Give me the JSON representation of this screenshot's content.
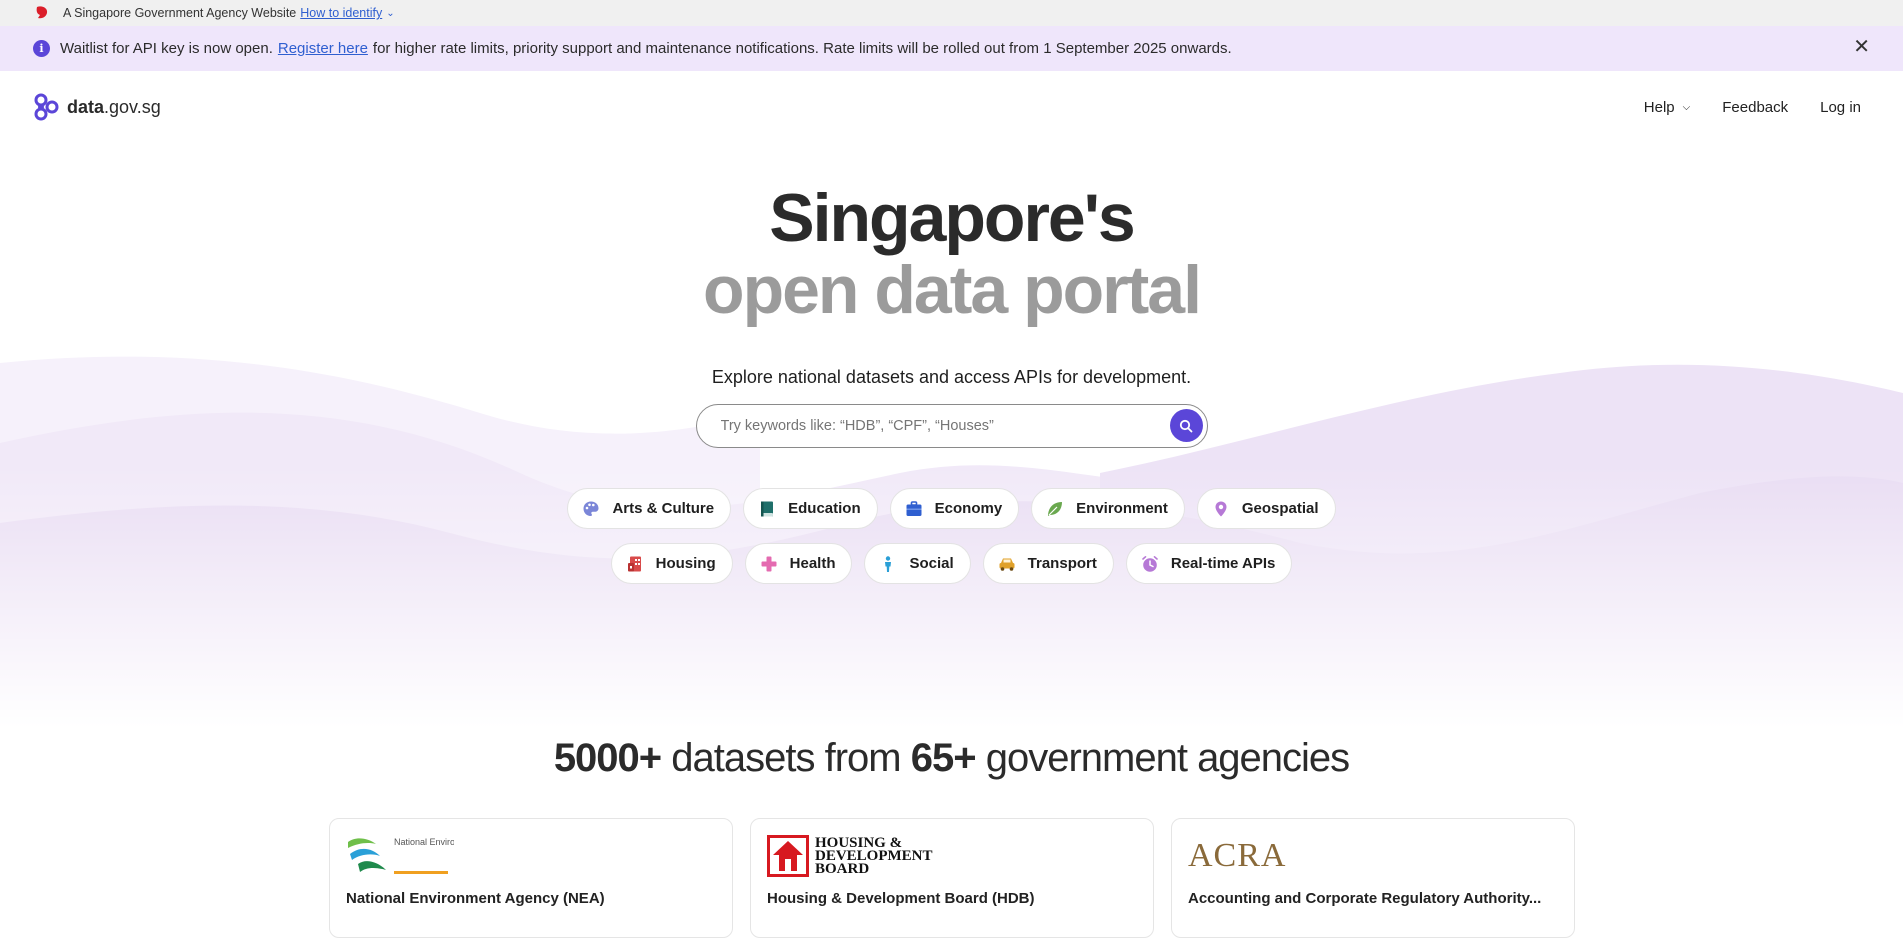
{
  "masthead": {
    "text": "A Singapore Government Agency Website",
    "link": "How to identify"
  },
  "banner": {
    "text_before": "Waitlist for API key is now open.",
    "link": "Register here",
    "text_after": "for higher rate limits, priority support and maintenance notifications. Rate limits will be rolled out from 1 September 2025 onwards.",
    "close": "✕"
  },
  "nav": {
    "logo_bold": "data",
    "logo_rest": ".gov.sg",
    "help": "Help",
    "feedback": "Feedback",
    "login": "Log in"
  },
  "hero": {
    "title_line1": "Singapore's",
    "title_line2": "open data portal",
    "subtitle": "Explore national datasets and access APIs for development.",
    "search_placeholder": "Try keywords like: “HDB”, “CPF”, “Houses”"
  },
  "categories_row1": [
    {
      "label": "Arts & Culture",
      "icon": "palette-icon",
      "color": "#7b86d8"
    },
    {
      "label": "Education",
      "icon": "book-icon",
      "color": "#1f6f6a"
    },
    {
      "label": "Economy",
      "icon": "briefcase-icon",
      "color": "#2f5fd0"
    },
    {
      "label": "Environment",
      "icon": "leaf-icon",
      "color": "#6aa84f"
    },
    {
      "label": "Geospatial",
      "icon": "pin-icon",
      "color": "#b679d6"
    }
  ],
  "categories_row2": [
    {
      "label": "Housing",
      "icon": "building-icon",
      "color": "#d84a4a"
    },
    {
      "label": "Health",
      "icon": "cross-icon",
      "color": "#e46bb0"
    },
    {
      "label": "Social",
      "icon": "person-icon",
      "color": "#2a9fd6"
    },
    {
      "label": "Transport",
      "icon": "car-icon",
      "color": "#e0a12a"
    },
    {
      "label": "Real-time APIs",
      "icon": "clock-icon",
      "color": "#b679d6"
    }
  ],
  "stats": {
    "datasets_count": "5000+",
    "datasets_text": "datasets from",
    "agencies_count": "65+",
    "agencies_text": "government agencies"
  },
  "agencies": [
    {
      "name": "National Environment Agency (NEA)",
      "logo_text": "National Environment Agency"
    },
    {
      "name": "Housing & Development Board (HDB)",
      "logo_text": "HOUSING & DEVELOPMENT BOARD"
    },
    {
      "name": "Accounting and Corporate Regulatory Authority...",
      "logo_text": "ACRA"
    }
  ]
}
